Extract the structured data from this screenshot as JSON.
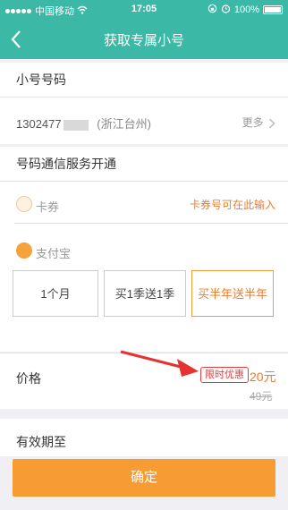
{
  "status_bar": {
    "carrier": "中国移动",
    "time": "17:05",
    "battery": "100%"
  },
  "nav": {
    "title": "获取专属小号",
    "back_icon": "chevron-left-icon"
  },
  "number_section": {
    "title": "小号号码",
    "number_prefix": "1302477",
    "area": "(浙江台州)",
    "more": "更多",
    "more_icon": "chevron-right-icon"
  },
  "service_section": {
    "title": "号码通信服务开通"
  },
  "payment": {
    "coupon_label": "卡券",
    "coupon_hint": "卡券号可在此输入",
    "alipay_label": "支付宝",
    "periods": [
      {
        "label": "1个月",
        "selected": false
      },
      {
        "label": "买1季送1季",
        "selected": false
      },
      {
        "label": "买半年送半年",
        "selected": true
      }
    ]
  },
  "price": {
    "label": "价格",
    "promo_badge": "限时优惠",
    "current": "20元",
    "original": "49元"
  },
  "validity": {
    "label": "有效期至"
  },
  "confirm_label": "确定",
  "colors": {
    "primary": "#3cb8a6",
    "accent": "#f79b33",
    "promo_red": "#e63d3d",
    "arrow_red": "#e8322f"
  }
}
